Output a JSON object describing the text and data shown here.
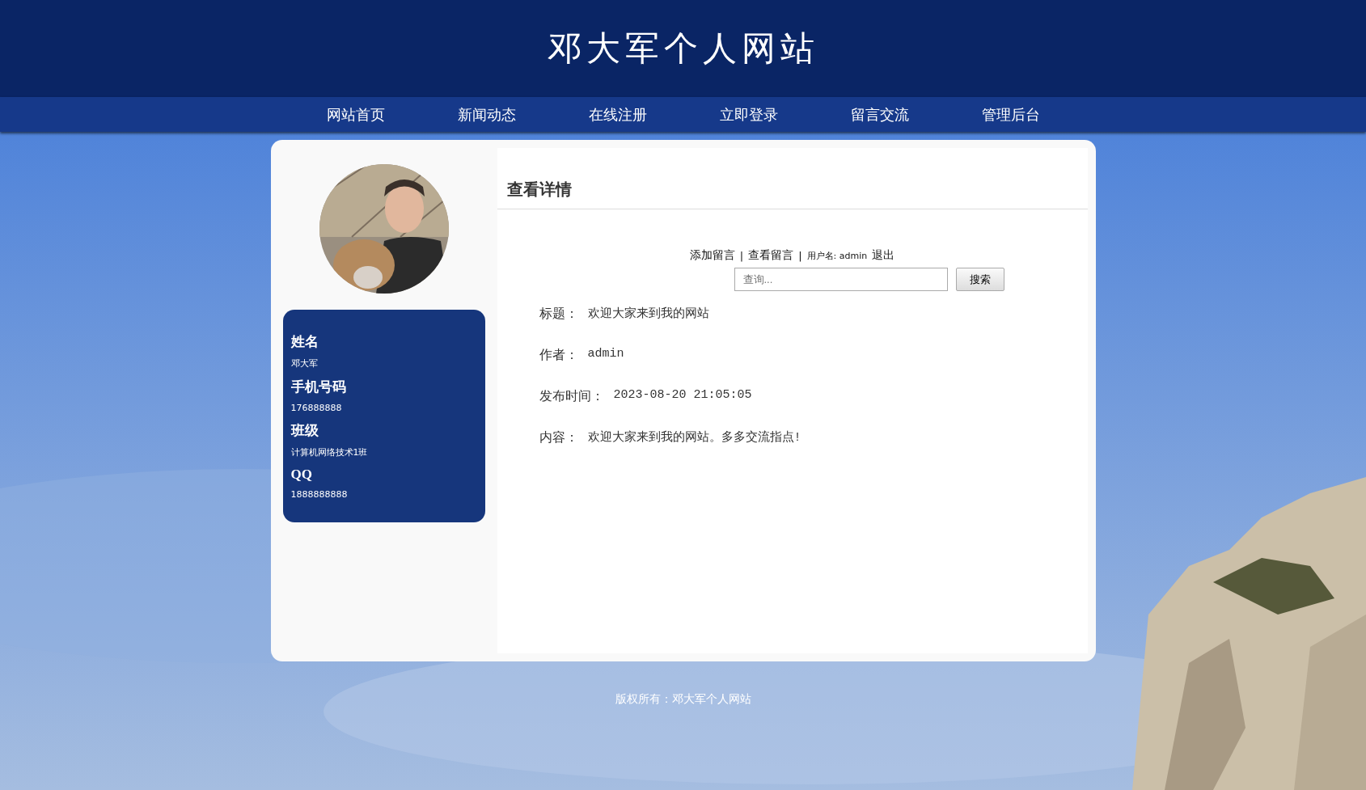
{
  "site_title": "邓大军个人网站",
  "nav": [
    "网站首页",
    "新闻动态",
    "在线注册",
    "立即登录",
    "留言交流",
    "管理后台"
  ],
  "profile": {
    "fields": [
      {
        "label": "姓名",
        "value": "邓大军"
      },
      {
        "label": "手机号码",
        "value": "176888888"
      },
      {
        "label": "班级",
        "value": "计算机网络技术1班"
      },
      {
        "label": "QQ",
        "value": "1888888888"
      }
    ]
  },
  "panel_title": "查看详情",
  "actions": [
    {
      "kind": "link",
      "text": "添加留言"
    },
    {
      "kind": "separator",
      "text": "|"
    },
    {
      "kind": "link",
      "text": "查看留言"
    },
    {
      "kind": "separator",
      "text": "|"
    },
    {
      "kind": "user",
      "text": "用户名: admin"
    },
    {
      "kind": "link",
      "text": "退出"
    }
  ],
  "search": {
    "placeholder": "查询...",
    "button": "搜索"
  },
  "details": [
    {
      "label": "标题：",
      "value": "欢迎大家来到我的网站"
    },
    {
      "label": "作者：",
      "value": "admin"
    },
    {
      "label": "发布时间：",
      "value": "2023-08-20 21:05:05"
    },
    {
      "label": "内容：",
      "value": "欢迎大家来到我的网站。多多交流指点!"
    }
  ],
  "footer": "版权所有：邓大军个人网站"
}
